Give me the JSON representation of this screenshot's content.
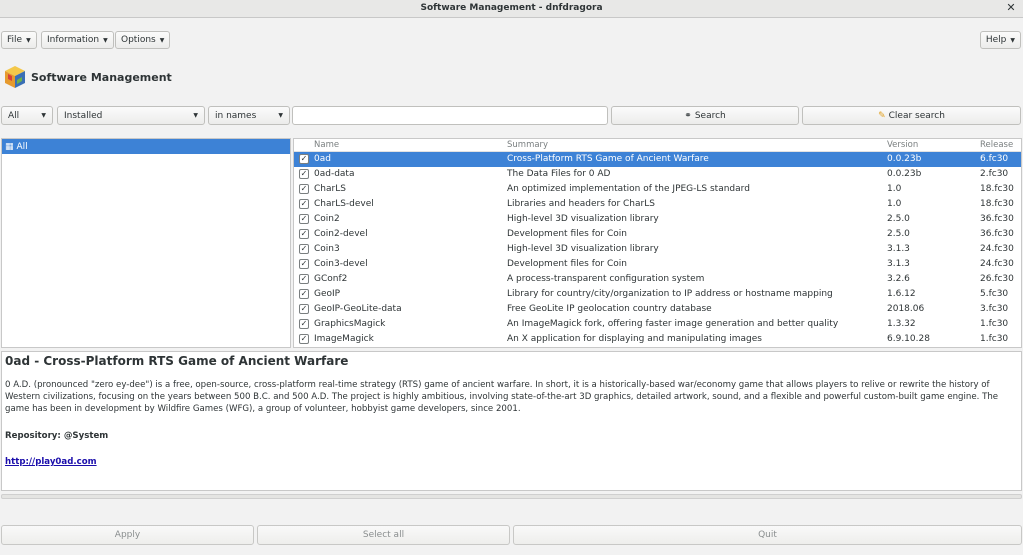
{
  "window": {
    "title": "Software Management - dnfdragora"
  },
  "menu": {
    "file": "File",
    "information": "Information",
    "options": "Options",
    "help": "Help"
  },
  "brand": {
    "name": "Software Management"
  },
  "filters": {
    "group": "All",
    "status": "Installed",
    "scope": "in names",
    "search_value": "",
    "search_label": "Search",
    "clear_label": "Clear search"
  },
  "groups": {
    "all": "All"
  },
  "table": {
    "headers": {
      "name": "Name",
      "summary": "Summary",
      "version": "Version",
      "release": "Release"
    },
    "rows": [
      {
        "name": "0ad",
        "summary": "Cross-Platform RTS Game of Ancient Warfare",
        "version": "0.0.23b",
        "release": "6.fc30"
      },
      {
        "name": "0ad-data",
        "summary": "The Data Files for 0 AD",
        "version": "0.0.23b",
        "release": "2.fc30"
      },
      {
        "name": "CharLS",
        "summary": "An optimized implementation of the JPEG-LS standard",
        "version": "1.0",
        "release": "18.fc30"
      },
      {
        "name": "CharLS-devel",
        "summary": "Libraries and headers for CharLS",
        "version": "1.0",
        "release": "18.fc30"
      },
      {
        "name": "Coin2",
        "summary": "High-level 3D visualization library",
        "version": "2.5.0",
        "release": "36.fc30"
      },
      {
        "name": "Coin2-devel",
        "summary": "Development files for Coin",
        "version": "2.5.0",
        "release": "36.fc30"
      },
      {
        "name": "Coin3",
        "summary": "High-level 3D visualization library",
        "version": "3.1.3",
        "release": "24.fc30"
      },
      {
        "name": "Coin3-devel",
        "summary": "Development files for Coin",
        "version": "3.1.3",
        "release": "24.fc30"
      },
      {
        "name": "GConf2",
        "summary": "A process-transparent configuration system",
        "version": "3.2.6",
        "release": "26.fc30"
      },
      {
        "name": "GeoIP",
        "summary": "Library for country/city/organization to IP address or hostname mapping",
        "version": "1.6.12",
        "release": "5.fc30"
      },
      {
        "name": "GeoIP-GeoLite-data",
        "summary": "Free GeoLite IP geolocation country database",
        "version": "2018.06",
        "release": "3.fc30"
      },
      {
        "name": "GraphicsMagick",
        "summary": "An ImageMagick fork, offering faster image generation and better quality",
        "version": "1.3.32",
        "release": "1.fc30"
      },
      {
        "name": "ImageMagick",
        "summary": "An X application for displaying and manipulating images",
        "version": "6.9.10.28",
        "release": "1.fc30"
      }
    ]
  },
  "details": {
    "title": "0ad - Cross-Platform RTS Game of Ancient Warfare",
    "description": "0 A.D. (pronounced \"zero ey-dee\") is a free, open-source, cross-platform real-time strategy (RTS) game of ancient warfare. In short, it is a historically-based war/economy game that allows players to relive or rewrite the history of Western civilizations, focusing on the years between 500 B.C. and 500 A.D. The project is highly ambitious, involving state-of-the-art 3D graphics, detailed artwork, sound, and a flexible and powerful custom-built game engine. The game has been in development by Wildfire Games (WFG), a group of volunteer, hobbyist game developers, since 2001.",
    "repository": "Repository: @System",
    "url": "http://play0ad.com"
  },
  "buttons": {
    "apply": "Apply",
    "select_all": "Select all",
    "quit": "Quit"
  }
}
